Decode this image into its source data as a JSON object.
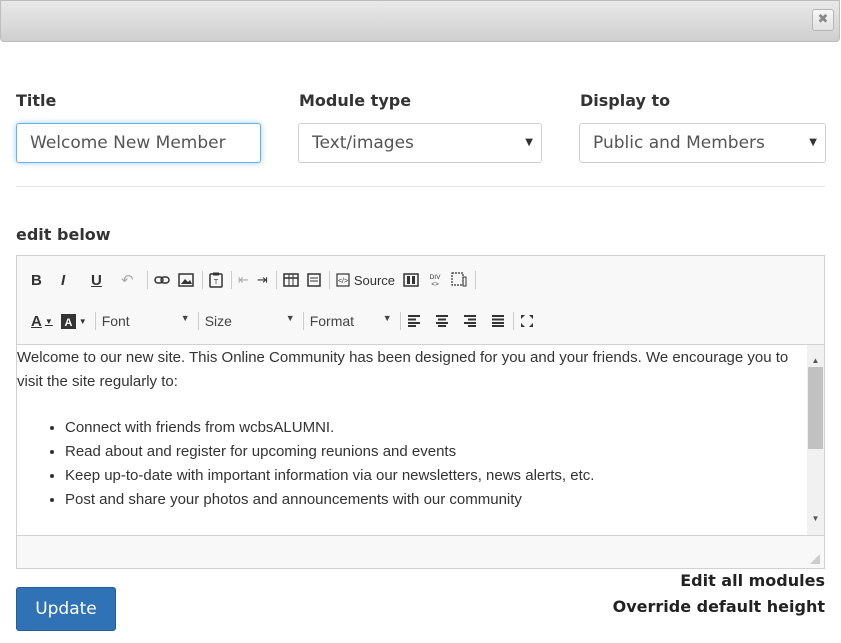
{
  "dialog": {
    "close_label": "✖"
  },
  "form": {
    "title_label": "Title",
    "title_value": "Welcome New Member",
    "module_type_label": "Module type",
    "module_type_value": "Text/images",
    "display_to_label": "Display to",
    "display_to_value": "Public and Members"
  },
  "editor": {
    "section_label": "edit below",
    "toolbar": {
      "bold": "B",
      "italic": "I",
      "underline": "U",
      "source_label": "Source",
      "font_label": "Font",
      "size_label": "Size",
      "format_label": "Format"
    },
    "content": {
      "intro": "Welcome to our new site.  This Online Community has been designed for you and your friends.  We encourage you to visit the site regularly to:",
      "bullets": [
        "Connect with friends from wcbsALUMNI.",
        "Read about and register for upcoming reunions and events",
        "Keep up-to-date with important information via our newsletters, news alerts, etc.",
        "Post and share your photos and announcements with our community"
      ]
    }
  },
  "actions": {
    "update_label": "Update",
    "edit_all_label": "Edit all modules",
    "override_label": "Override default height"
  },
  "colors": {
    "primary_button": "#2f72b5",
    "focus_border": "#66afe9"
  }
}
